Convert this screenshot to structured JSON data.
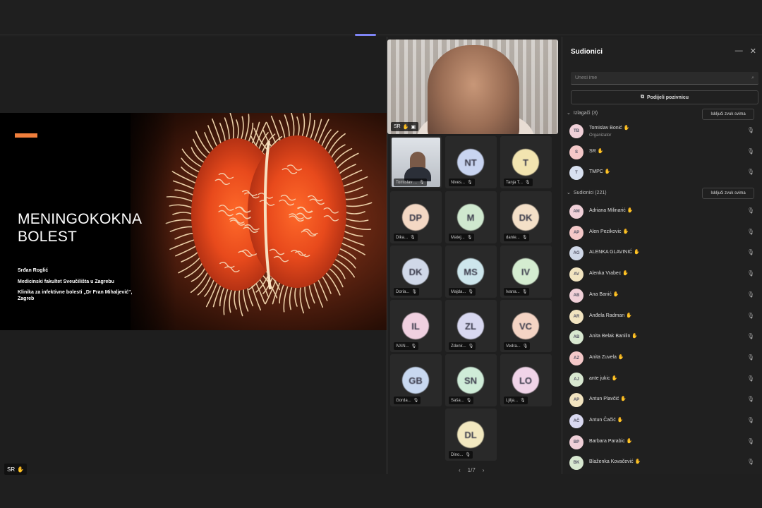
{
  "slide": {
    "title_line1": "MENINGOKOKNA",
    "title_line2": "BOLEST",
    "author": "Srđan Roglić",
    "affiliation1": "Medicinski fakultet Sveučilišta u Zagrebu",
    "affiliation2": "Klinika za infektivne bolesti „Dr Fran Mihaljević\", Zagreb",
    "accent_color": "#f07f3c"
  },
  "presenter_badge": {
    "initials": "SR",
    "icon": "hand-icon"
  },
  "main_video": {
    "label": "SR",
    "icon1": "hand-icon",
    "icon2": "screen-icon"
  },
  "tiles": [
    {
      "initials": "",
      "name": "Tomislav ...",
      "camera": true
    },
    {
      "initials": "NT",
      "name": "Nives...",
      "color": "#c8d4f0"
    },
    {
      "initials": "T",
      "name": "Tanja T...",
      "color": "#f2e4b0"
    },
    {
      "initials": "DP",
      "name": "Dika...",
      "color": "#f4d8c4"
    },
    {
      "initials": "M",
      "name": "Matej...",
      "color": "#cfe8cf"
    },
    {
      "initials": "DK",
      "name": "danie...",
      "color": "#f4e0c8"
    },
    {
      "initials": "DK",
      "name": "Doria...",
      "color": "#d0d8e8"
    },
    {
      "initials": "MS",
      "name": "Majda...",
      "color": "#cde6ec"
    },
    {
      "initials": "IV",
      "name": "Ivana...",
      "color": "#d4ecd0"
    },
    {
      "initials": "IL",
      "name": "IVAN...",
      "color": "#f0d0e0"
    },
    {
      "initials": "ZL",
      "name": "Zdenk...",
      "color": "#d8d8f0"
    },
    {
      "initials": "VC",
      "name": "Vedra...",
      "color": "#f4d4c4"
    },
    {
      "initials": "GB",
      "name": "Gorda...",
      "color": "#c8d8f0"
    },
    {
      "initials": "SN",
      "name": "Saša...",
      "color": "#cfecd8"
    },
    {
      "initials": "LO",
      "name": "Ljilja...",
      "color": "#f0d4e8"
    },
    {
      "initials": "DL",
      "name": "Dino...",
      "color": "#f2e8c0"
    }
  ],
  "pager": {
    "prev": "‹",
    "label": "1/7",
    "next": "›"
  },
  "panel": {
    "title": "Sudionici",
    "minimize": "—",
    "close": "✕",
    "search_placeholder": "Unesi ime",
    "share_label": "Podijeli pozivnicu",
    "section1": {
      "label": "Izlagači (3)",
      "button": "Isključi zvuk svima"
    },
    "section2": {
      "label": "Sudionici (221)",
      "button": "Isključi zvuk svima"
    },
    "presenters": [
      {
        "initials": "TB",
        "name": "Tomislav Bonić",
        "role": "Organizator",
        "color": "#f0d0d8"
      },
      {
        "initials": "S",
        "name": "SR",
        "color": "#f4c8c8"
      },
      {
        "initials": "T",
        "name": "TMPC",
        "color": "#d8e0f0"
      }
    ],
    "attendees": [
      {
        "initials": "AM",
        "name": "Adriana Milinarić",
        "color": "#f0d0d8"
      },
      {
        "initials": "AP",
        "name": "Alen Pezikovic",
        "color": "#f4c8c8"
      },
      {
        "initials": "AG",
        "name": "ALENKA GLAVINIĆ",
        "color": "#d0d8e8"
      },
      {
        "initials": "AV",
        "name": "Alenka Vrabec",
        "color": "#f2e4c0"
      },
      {
        "initials": "AB",
        "name": "Ana Banić",
        "color": "#f0d0d8"
      },
      {
        "initials": "AR",
        "name": "Anđela Radman",
        "color": "#f2e4c0"
      },
      {
        "initials": "AB",
        "name": "Anita Belak Banilin",
        "color": "#d8e8d0"
      },
      {
        "initials": "AZ",
        "name": "Anita Zuvela",
        "color": "#f4c8c8"
      },
      {
        "initials": "AJ",
        "name": "ante jukic",
        "color": "#d8e8d0"
      },
      {
        "initials": "AP",
        "name": "Antun Plavčić",
        "color": "#f2e4c0"
      },
      {
        "initials": "AČ",
        "name": "Antun Čačić",
        "color": "#d8d8f0"
      },
      {
        "initials": "BP",
        "name": "Barbara Parabic",
        "color": "#f0d0d8"
      },
      {
        "initials": "BK",
        "name": "Blaženka Kovačević",
        "color": "#d8e8d0"
      }
    ]
  }
}
